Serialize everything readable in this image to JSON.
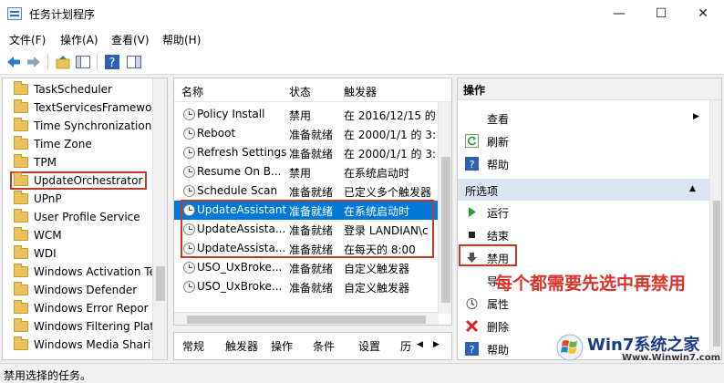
{
  "window": {
    "title": "任务计划程序",
    "minimize": "—",
    "maximize": "☐",
    "close": "✕"
  },
  "menu": [
    "文件(F)",
    "操作(A)",
    "查看(V)",
    "帮助(H)"
  ],
  "tree": {
    "items": [
      {
        "label": "TaskScheduler"
      },
      {
        "label": "TextServicesFramewor"
      },
      {
        "label": "Time Synchronization"
      },
      {
        "label": "Time Zone"
      },
      {
        "label": "TPM"
      },
      {
        "label": "UpdateOrchestrator"
      },
      {
        "label": "UPnP"
      },
      {
        "label": "User Profile Service"
      },
      {
        "label": "WCM"
      },
      {
        "label": "WDI"
      },
      {
        "label": "Windows Activation Te"
      },
      {
        "label": "Windows Defender"
      },
      {
        "label": "Windows Error Repor"
      },
      {
        "label": "Windows Filtering Plat"
      },
      {
        "label": "Windows Media Shari"
      }
    ],
    "selected": "UpdateOrchestrator"
  },
  "list": {
    "columns": [
      "名称",
      "状态",
      "触发器"
    ],
    "rows": [
      {
        "name": "Policy Install",
        "status": "禁用",
        "trigger": "在 2016/12/15 的"
      },
      {
        "name": "Reboot",
        "status": "准备就绪",
        "trigger": "在 2000/1/1 的 3:"
      },
      {
        "name": "Refresh Settings",
        "status": "准备就绪",
        "trigger": "在 2000/1/1 的 3:"
      },
      {
        "name": "Resume On B...",
        "status": "禁用",
        "trigger": "在系统启动时"
      },
      {
        "name": "Schedule Scan",
        "status": "准备就绪",
        "trigger": "已定义多个触发器"
      },
      {
        "name": "UpdateAssistant",
        "status": "准备就绪",
        "trigger": "在系统启动时"
      },
      {
        "name": "UpdateAssista...",
        "status": "准备就绪",
        "trigger": "登录 LANDIAN\\c"
      },
      {
        "name": "UpdateAssista...",
        "status": "准备就绪",
        "trigger": "在每天的 8:00"
      },
      {
        "name": "USO_UxBroke...",
        "status": "准备就绪",
        "trigger": "自定义触发器"
      },
      {
        "name": "USO_UxBroke...",
        "status": "准备就绪",
        "trigger": "自定义触发器"
      }
    ],
    "selected_index": 5
  },
  "tabs": [
    "常规",
    "触发器",
    "操作",
    "条件",
    "设置",
    "历"
  ],
  "actions": {
    "header": "操作",
    "top": [
      {
        "label": "查看",
        "icon": "view-icon"
      },
      {
        "label": "刷新",
        "icon": "refresh-icon"
      },
      {
        "label": "帮助",
        "icon": "help-icon"
      }
    ],
    "section": "所选项",
    "items": [
      {
        "label": "运行",
        "icon": "run-icon"
      },
      {
        "label": "结束",
        "icon": "stop-icon"
      },
      {
        "label": "禁用",
        "icon": "disable-icon"
      },
      {
        "label": "导",
        "icon": "export-icon"
      },
      {
        "label": "属性",
        "icon": "properties-icon"
      },
      {
        "label": "删除",
        "icon": "delete-icon"
      },
      {
        "label": "帮助",
        "icon": "help-icon"
      }
    ]
  },
  "annotation": "每个都需要先选中再禁用",
  "status": "禁用选择的任务。",
  "watermark": {
    "brand": "Win7系统之家",
    "url": "Www.Winwin7.com"
  },
  "colors": {
    "selection": "#0078d7",
    "annotation": "#d9342b",
    "highlight_box": "#c0392b"
  }
}
